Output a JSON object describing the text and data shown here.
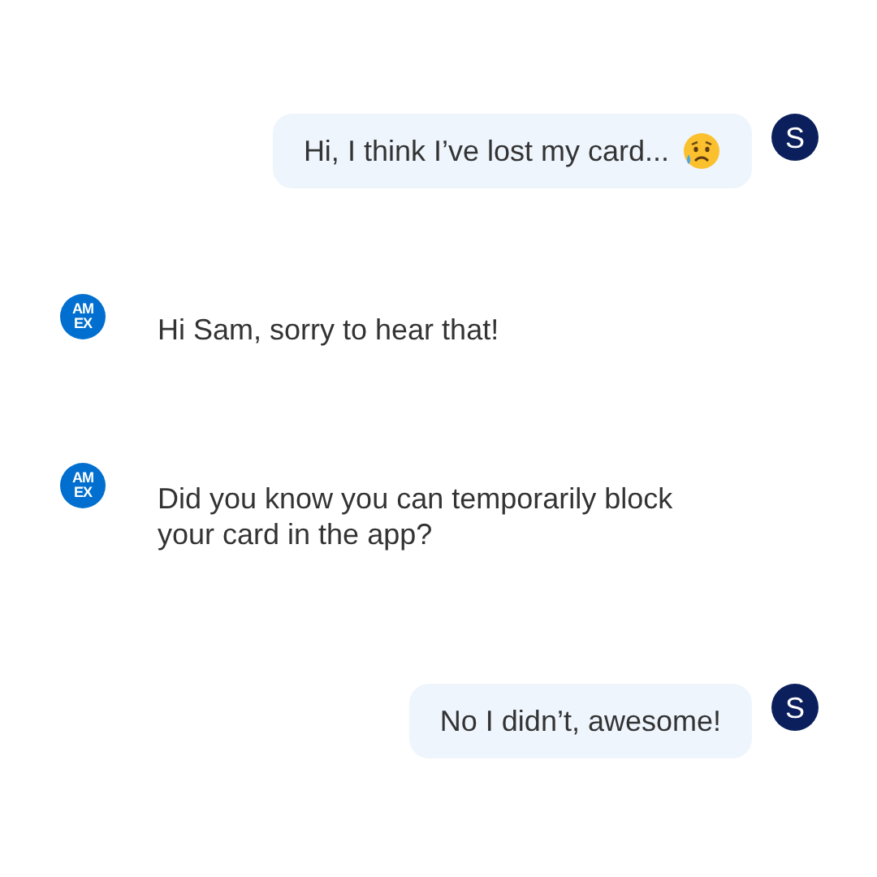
{
  "messages": [
    {
      "kind": "user",
      "text": "Hi, I think I’ve lost my card...",
      "emoji": true,
      "avatar": "S"
    },
    {
      "kind": "bot",
      "logo": [
        "AM",
        "EX"
      ],
      "text": "Hi Sam, sorry to hear that!"
    },
    {
      "kind": "bot",
      "logo": [
        "AM",
        "EX"
      ],
      "text": "Did you know you can temporarily block your card in the app?"
    },
    {
      "kind": "user",
      "text": "No I didn’t, awesome!",
      "emoji": false,
      "avatar": "S"
    }
  ]
}
